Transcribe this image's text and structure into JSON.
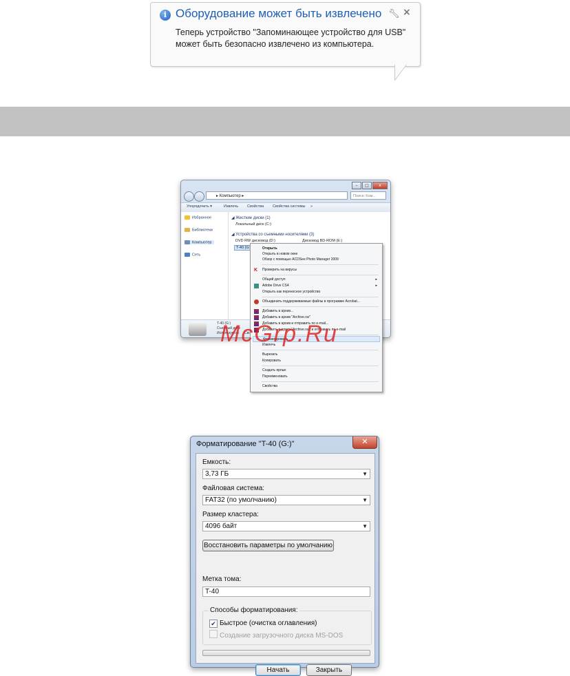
{
  "balloon": {
    "title": "Оборудование может быть извлечено",
    "body": "Теперь устройство \"Запоминающее устройство для USB\" может быть безопасно извлечено из компьютера.",
    "icons": [
      "info-icon",
      "wrench-icon",
      "close-icon"
    ]
  },
  "explorer": {
    "address": "▸ Компьютер ▸",
    "search_placeholder": "Поиск: Ком...",
    "toolbar": [
      "Упорядочить ▾",
      "Извлечь",
      "Свойства",
      "Свойства системы",
      "»"
    ],
    "nav": [
      "Избранное",
      "Библиотеки",
      "Компьютер",
      "Сеть"
    ],
    "groups": {
      "hdd": "◢ Жесткие диски (1)",
      "removable": "◢ Устройства со съемными носителями (3)"
    },
    "drives": {
      "local": "Локальный диск (C:)",
      "dvd": "DVD RW дисковод (D:)",
      "bd": "Дисковод BD-ROM (E:)",
      "usb": "T-40 (G:)"
    },
    "details": {
      "name": "T-40 (G:)",
      "type": "Съемный диск",
      "used": "Используется:",
      "free": "Свободно: 3,72 ГБ"
    }
  },
  "context_menu": {
    "items": [
      {
        "label": "Открыть",
        "bold": true
      },
      {
        "label": "Открыть в новом окне"
      },
      {
        "label": "Обзор с помощью ACDSee Photo Manager 2009"
      },
      {
        "label": "Проверить на вирусы"
      },
      {
        "label": "Общий доступ",
        "submenu": true
      },
      {
        "label": "Adobe Drive CS4",
        "submenu": true
      },
      {
        "label": "Открыть как переносное устройство"
      },
      {
        "label": "Объединить поддерживаемые файлы в программе Acrobat..."
      },
      {
        "label": "Добавить в архив..."
      },
      {
        "label": "Добавить в архив \"Archive.rar\""
      },
      {
        "label": "Добавить в архив и отправить по e-mail..."
      },
      {
        "label": "Добавить в архив \"Archive.rar\" и отправить по e-mail"
      },
      {
        "label": "Форматировать...",
        "highlighted": true
      },
      {
        "label": "Извлечь"
      },
      {
        "label": "Вырезать"
      },
      {
        "label": "Копировать"
      },
      {
        "label": "Создать ярлык"
      },
      {
        "label": "Переименовать"
      },
      {
        "label": "Свойства"
      }
    ],
    "submenu_arrow": "▸"
  },
  "watermark": "McGrp.Ru",
  "format_dialog": {
    "title": "Форматирование \"T-40 (G:)\"",
    "close": "✕",
    "capacity_label": "Емкость:",
    "capacity_value": "3,73 ГБ",
    "fs_label": "Файловая система:",
    "fs_value": "FAT32 (по умолчанию)",
    "cluster_label": "Размер кластера:",
    "cluster_value": "4096 байт",
    "restore_button": "Восстановить параметры по умолчанию",
    "volume_label": "Метка тома:",
    "volume_value": "T-40",
    "methods_title": "Способы форматирования:",
    "quick": {
      "label": "Быстрое (очистка оглавления)",
      "checked": true
    },
    "msdos": {
      "label": "Создание загрузочного диска MS-DOS",
      "checked": false,
      "enabled": false
    },
    "progress": 0,
    "start_button": "Начать",
    "close_button": "Закрыть",
    "dropdown_glyph": "▼"
  }
}
